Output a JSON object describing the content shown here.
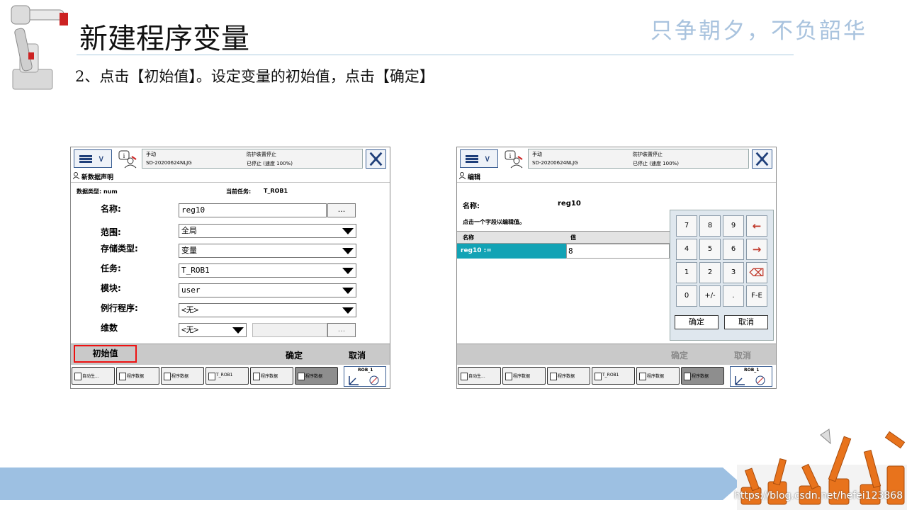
{
  "slide": {
    "title": "新建程序变量",
    "slogan": "只争朝夕，不负韶华",
    "instruction": "2、点击【初始值】。设定变量的初始值，点击【确定】",
    "watermark": "https://blog.csdn.net/hefei123868"
  },
  "colors": {
    "accent_blue": "#1f3f7a",
    "highlight_teal": "#12a3b5",
    "red_outline": "#e11111",
    "footer_blue": "#9dc0e2"
  },
  "status_bar": {
    "mode": "手动",
    "controller": "SD-20200624NLJG",
    "safety": "防护装置停止",
    "state": "已停止 (速度 100%)",
    "menu_icon": "hamburger-chevron-icon",
    "close_icon": "close-x-icon"
  },
  "left_screen": {
    "window_title": "新数据声明",
    "data_type_label": "数据类型: num",
    "current_task_label": "当前任务:",
    "current_task_value": "T_ROB1",
    "fields": [
      {
        "label": "名称:",
        "value": "reg10"
      },
      {
        "label": "范围:",
        "value": "全局"
      },
      {
        "label": "存储类型:",
        "value": "变量"
      },
      {
        "label": "任务:",
        "value": "T_ROB1"
      },
      {
        "label": "模块:",
        "value": "user"
      },
      {
        "label": "例行程序:",
        "value": "<无>"
      },
      {
        "label": "维数",
        "value": "<无>"
      }
    ],
    "dots_label": "...",
    "commands": {
      "init": "初始值",
      "ok": "确定",
      "cancel": "取消"
    }
  },
  "right_screen": {
    "window_title": "编辑",
    "name_label": "名称:",
    "name_value": "reg10",
    "hint": "点击一个字段以编辑值。",
    "columns": [
      "名称",
      "值"
    ],
    "row": {
      "name": "reg10 :=",
      "value": "8"
    },
    "keypad": {
      "keys": [
        "7",
        "8",
        "9",
        "←",
        "4",
        "5",
        "6",
        "→",
        "1",
        "2",
        "3",
        "⌫",
        "0",
        "+/-",
        ".",
        "F-E"
      ],
      "ok": "确定",
      "cancel": "取消"
    },
    "commands": {
      "ok": "确定",
      "cancel": "取消"
    }
  },
  "task_bar": {
    "left_tabs": [
      "自动生...",
      "程序数据",
      "程序数据",
      "T_ROB1",
      "程序数据",
      "程序数据"
    ],
    "right_tabs": [
      "自动生...",
      "程序数据",
      "程序数据",
      "T_ROB1",
      "程序数据",
      "程序数据"
    ],
    "active_index": 5,
    "quickset_label": "ROB_1"
  }
}
